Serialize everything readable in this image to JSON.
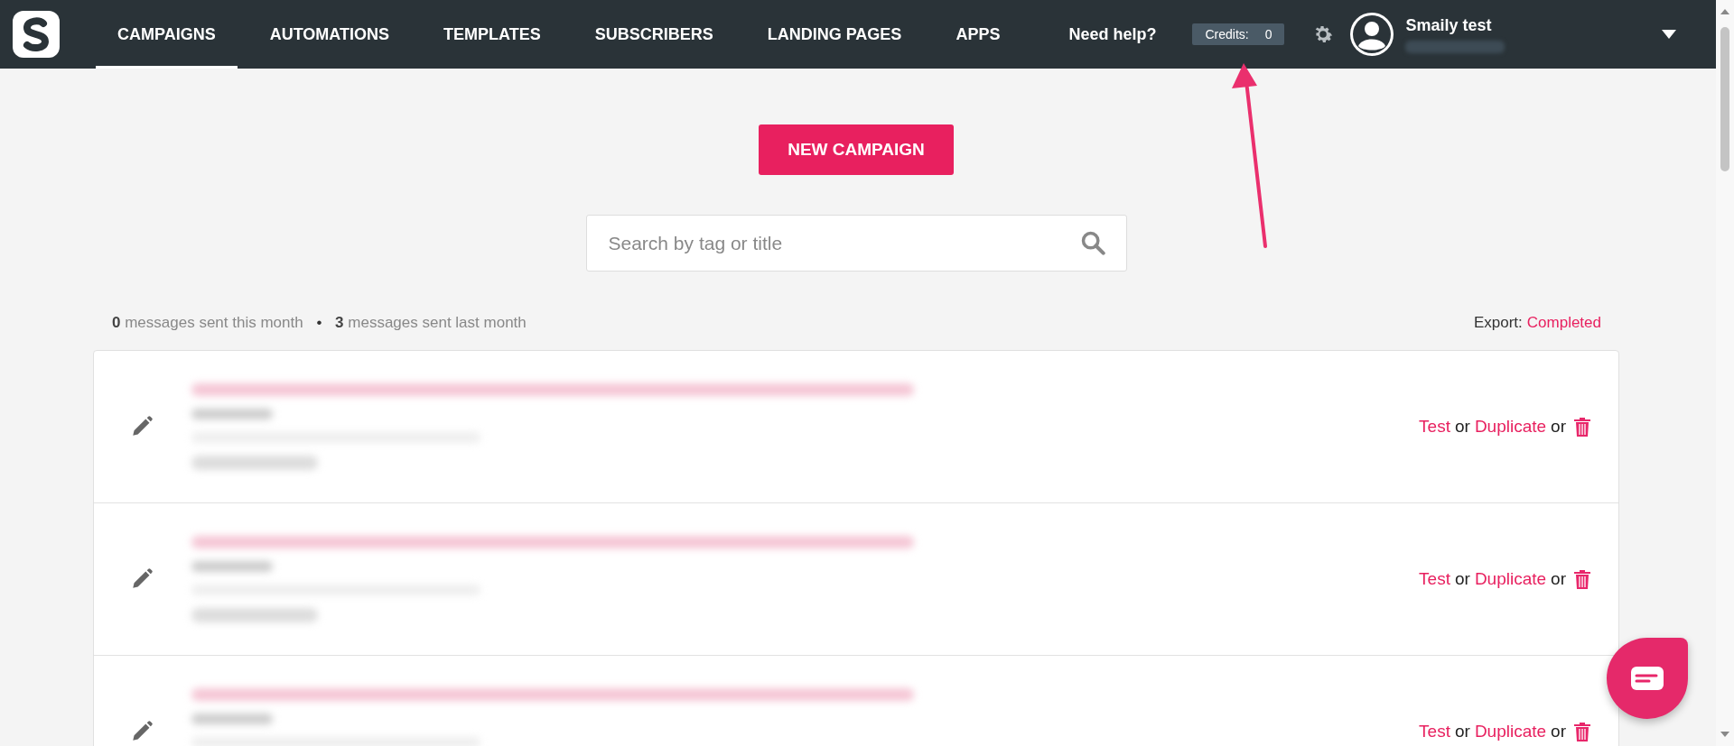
{
  "nav": {
    "tabs": [
      {
        "label": "CAMPAIGNS",
        "selected": true
      },
      {
        "label": "AUTOMATIONS",
        "selected": false
      },
      {
        "label": "TEMPLATES",
        "selected": false
      },
      {
        "label": "SUBSCRIBERS",
        "selected": false
      },
      {
        "label": "LANDING PAGES",
        "selected": false
      },
      {
        "label": "APPS",
        "selected": false
      }
    ],
    "help": "Need help?",
    "credits_label": "Credits:",
    "credits_value": "0",
    "user_name": "Smaily test"
  },
  "new_campaign": "NEW CAMPAIGN",
  "search": {
    "placeholder": "Search by tag or title"
  },
  "stats": {
    "this_month_count": "0",
    "this_month_text": "messages sent this month",
    "separator": "•",
    "last_month_count": "3",
    "last_month_text": "messages sent last month"
  },
  "export": {
    "label": "Export:",
    "status": "Completed"
  },
  "campaigns": [
    {
      "test": "Test",
      "or_1": "or",
      "duplicate": "Duplicate",
      "or_2": "or"
    },
    {
      "test": "Test",
      "or_1": "or",
      "duplicate": "Duplicate",
      "or_2": "or"
    },
    {
      "test": "Test",
      "or_1": "or",
      "duplicate": "Duplicate",
      "or_2": "or"
    }
  ]
}
